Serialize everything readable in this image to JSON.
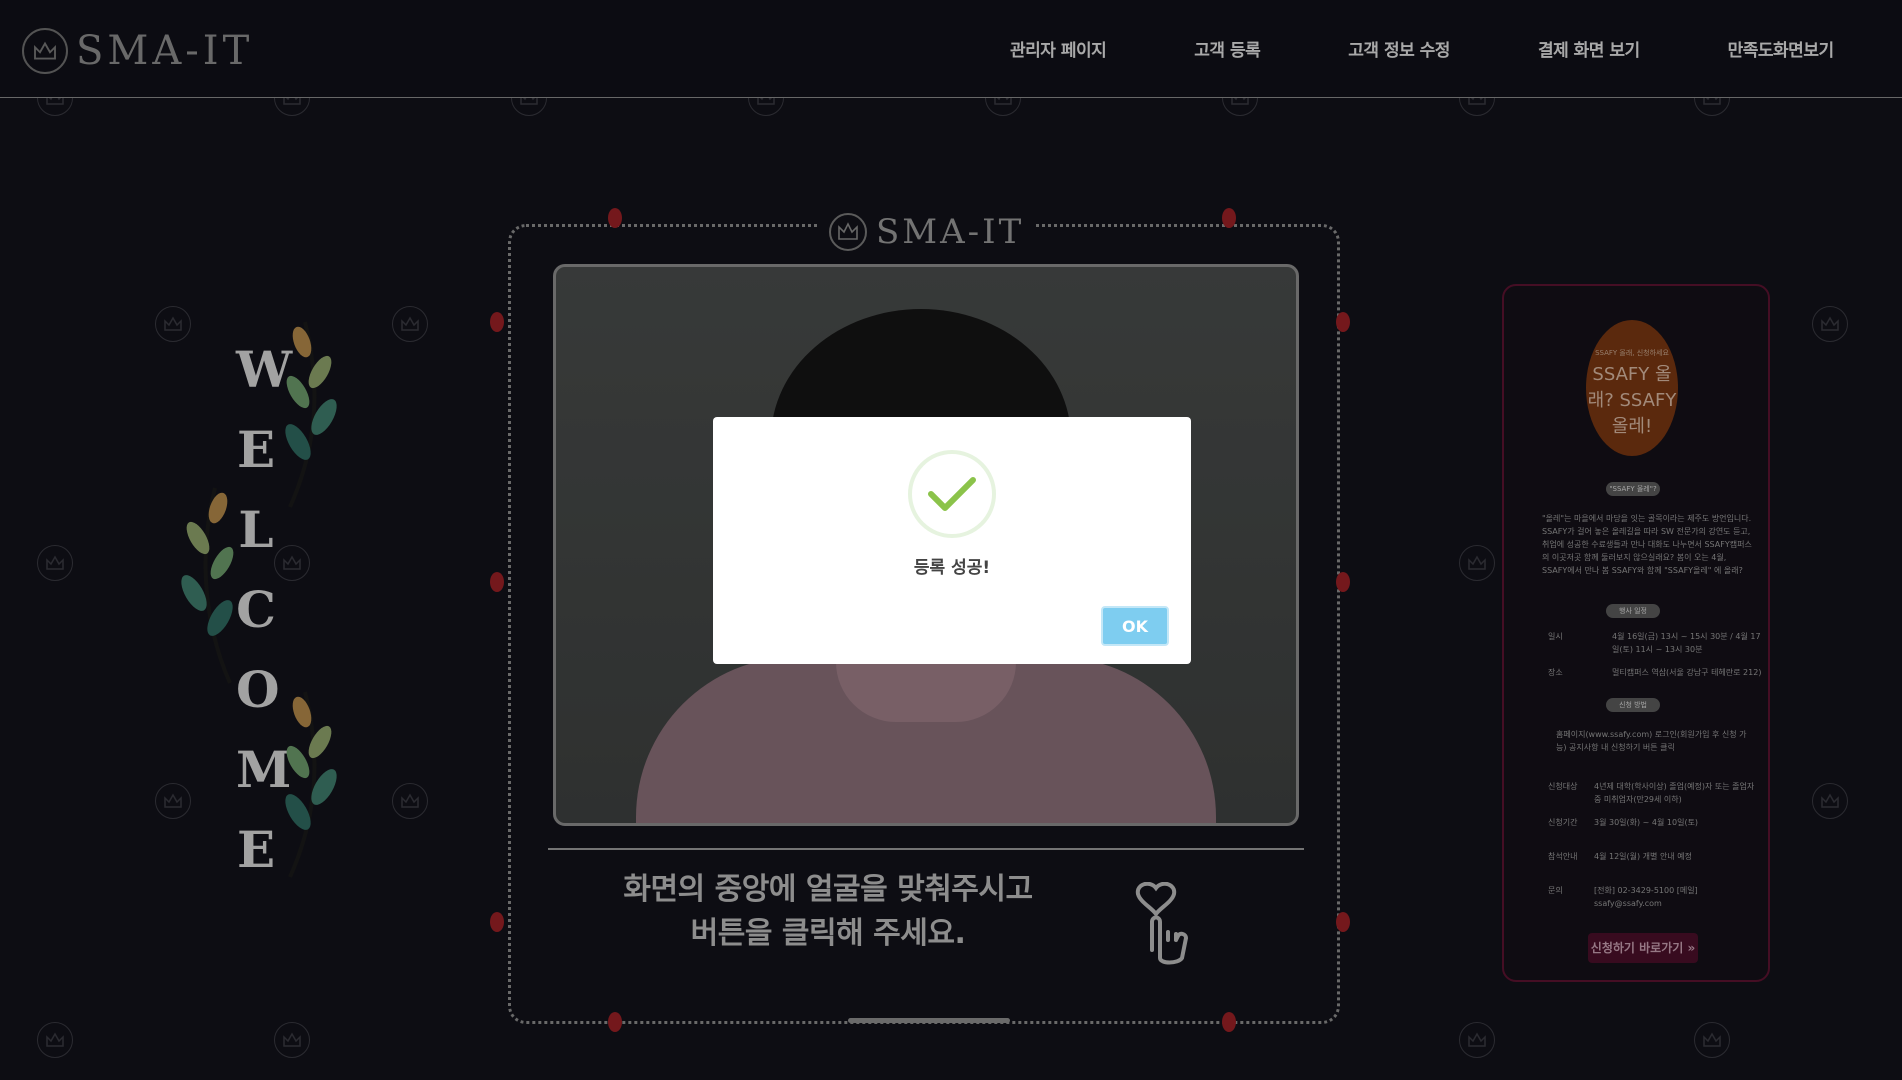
{
  "header": {
    "logo_text": "SMA-IT",
    "nav": [
      {
        "label": "관리자 페이지"
      },
      {
        "label": "고객 등록"
      },
      {
        "label": "고객 정보 수정"
      },
      {
        "label": "결제 화면 보기"
      },
      {
        "label": "만족도화면보기"
      }
    ]
  },
  "welcome": {
    "letters": [
      "W",
      "E",
      "L",
      "C",
      "O",
      "M",
      "E"
    ]
  },
  "frame": {
    "logo_text": "SMA-IT",
    "instruction": "화면의 중앙에 얼굴을 맞춰주시고 버튼을 클릭해 주세요."
  },
  "poster": {
    "headline": "SSAFY 올래? SSAFY 올레!",
    "tag": "SSAFY 올래, 신청하세요",
    "section1": "\"SSAFY 올레\"?",
    "body": "\"올레\"는 마을에서 마당을 잇는 골목이라는 제주도 방언입니다. SSAFY가 걸어 놓은 올레길을 따라 SW 전문가의 강연도 듣고, 취업에 성공한 수료생들과 만나 대화도 나누면서 SSAFY캠퍼스의 이곳저곳 함께 둘러보지 않으실래요? 봄이 오는 4월, SSAFY에서 만나 봄 SSAFY와 함께 \"SSAFY올레\" 에 올래?",
    "section2": "행사 일정",
    "date_label": "일시",
    "date_value": "4월 16일(금) 13시 ~ 15시 30분 / 4월 17일(토) 11시 ~ 13시 30분",
    "place_label": "장소",
    "place_value": "멀티캠퍼스 역삼(서울 강남구 테헤란로 212)",
    "section3": "신청 방법",
    "method": "홈페이지(www.ssafy.com) 로그인(회원가입 후 신청 가능) 공지사항 내 신청하기 버튼 클릭",
    "target_label": "신청대상",
    "target_value": "4년제 대학(학사이상) 졸업(예정)자 또는 졸업자 중 미취업자(만29세 이하)",
    "period_label": "신청기간",
    "period_value": "3월 30일(화) ~ 4월 10일(토)",
    "notice_label": "참석안내",
    "notice_value": "4월 12일(월) 개별 안내 예정",
    "contact_label": "문의",
    "contact_value": "[전화] 02-3429-5100 [메일] ssafy@ssafy.com",
    "apply_button": "신청하기 바로가기 »"
  },
  "modal": {
    "title": "등록 성공!",
    "ok_label": "OK",
    "accent": "#7ecdf0",
    "check_color": "#8bc34a"
  },
  "icons": {
    "watermark": "crown-icon",
    "check": "check-icon",
    "hand": "tap-hand-heart-icon"
  }
}
